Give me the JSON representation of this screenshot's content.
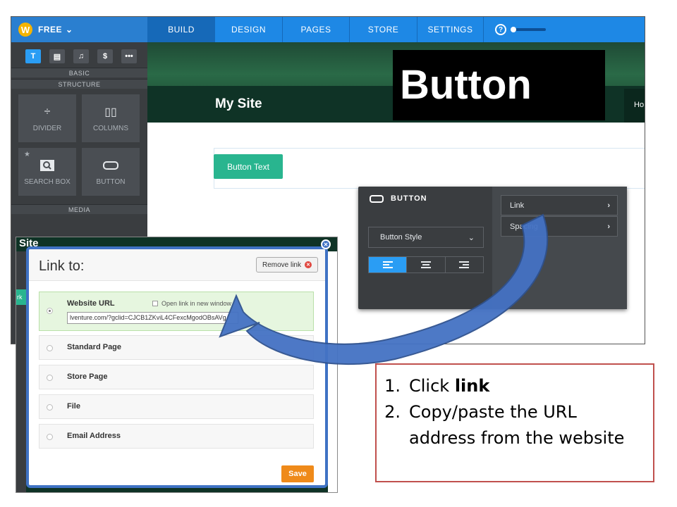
{
  "editor": {
    "brand": {
      "plan_label": "FREE",
      "logo": "W"
    },
    "nav_tabs": [
      {
        "label": "BUILD",
        "active": true
      },
      {
        "label": "DESIGN",
        "active": false
      },
      {
        "label": "PAGES",
        "active": false
      },
      {
        "label": "STORE",
        "active": false
      },
      {
        "label": "SETTINGS",
        "active": false
      }
    ],
    "help_icon": "?",
    "sidebar": {
      "tool_tabs": [
        {
          "icon": "T",
          "name": "text-tool-icon",
          "active": true
        },
        {
          "icon": "▤",
          "name": "layout-tool-icon",
          "active": false
        },
        {
          "icon": "♫",
          "name": "music-tool-icon",
          "active": false
        },
        {
          "icon": "$",
          "name": "store-tool-icon",
          "active": false
        },
        {
          "icon": "•••",
          "name": "more-tools-icon",
          "active": false
        }
      ],
      "section_basic": "BASIC",
      "section_structure": "STRUCTURE",
      "tiles": [
        {
          "label": "DIVIDER",
          "icon": "÷",
          "icon_name": "divider-icon"
        },
        {
          "label": "COLUMNS",
          "icon": "▯▯",
          "icon_name": "columns-icon"
        },
        {
          "label": "SEARCH BOX",
          "icon": "🔍",
          "icon_name": "search-box-icon",
          "starred": true
        },
        {
          "label": "BUTTON",
          "icon": "▭",
          "icon_name": "button-element-icon"
        }
      ],
      "section_media": "MEDIA"
    },
    "site": {
      "title": "My Site",
      "nav_partial": "Ho"
    },
    "overlay_label": "Button",
    "page": {
      "button_text": "Button Text"
    },
    "button_panel": {
      "title": "BUTTON",
      "style_select": "Button Style",
      "alignments": [
        "left",
        "center",
        "right"
      ],
      "rows": [
        {
          "label": "Link"
        },
        {
          "label": "Spacing"
        }
      ]
    }
  },
  "link_dialog": {
    "background_label": "Site",
    "background_partial": "rk",
    "title": "Link to:",
    "remove_link": "Remove link",
    "options": [
      {
        "label": "Website URL",
        "selected": true
      },
      {
        "label": "Standard Page",
        "selected": false
      },
      {
        "label": "Store Page",
        "selected": false
      },
      {
        "label": "File",
        "selected": false
      },
      {
        "label": "Email Address",
        "selected": false
      }
    ],
    "open_new_window": "Open link in new window",
    "url_value": "lventure.com/?gclid=CJCB1ZKviL4CFexcMgodOBsAVg",
    "save": "Save"
  },
  "instructions": {
    "step1_num": "1.",
    "step1_text": "Click ",
    "step1_bold": "link",
    "step2_num": "2.",
    "step2_text": "Copy/paste the URL address from the website"
  },
  "colors": {
    "topbar": "#1e88e5",
    "sidebar": "#3a3d40",
    "button_green": "#29b58f",
    "save_orange": "#ef8a1a",
    "dialog_border": "#3f72c4",
    "instruction_border": "#c0504d",
    "arrow": "#4472c4"
  }
}
